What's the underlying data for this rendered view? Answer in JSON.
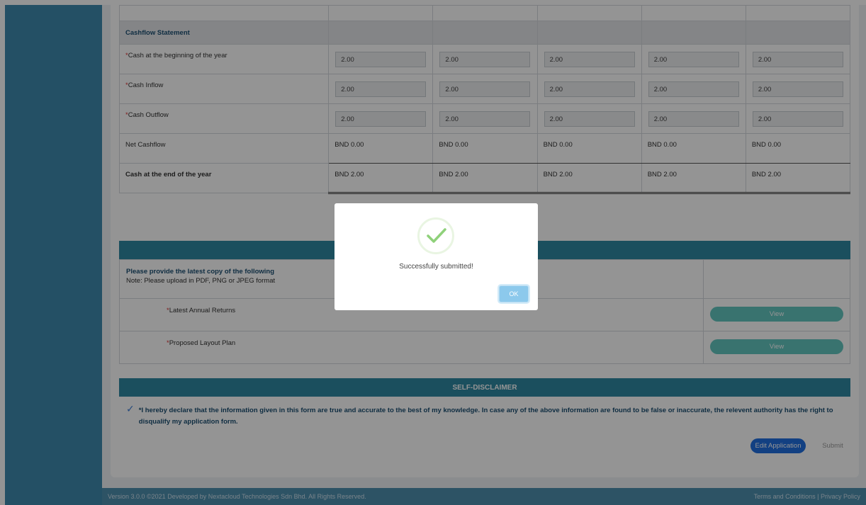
{
  "cashflow": {
    "section_title": "Cashflow Statement",
    "rows": [
      {
        "label": "Cash at the beginning of the year",
        "required": true,
        "type": "input",
        "values": [
          "2.00",
          "2.00",
          "2.00",
          "2.00",
          "2.00"
        ]
      },
      {
        "label": "Cash Inflow",
        "required": true,
        "type": "input",
        "values": [
          "2.00",
          "2.00",
          "2.00",
          "2.00",
          "2.00"
        ]
      },
      {
        "label": "Cash Outflow",
        "required": true,
        "type": "input",
        "values": [
          "2.00",
          "2.00",
          "2.00",
          "2.00",
          "2.00"
        ]
      },
      {
        "label": "Net Cashflow",
        "required": false,
        "type": "text",
        "values": [
          "BND 0.00",
          "BND 0.00",
          "BND 0.00",
          "BND 0.00",
          "BND 0.00"
        ]
      },
      {
        "label": "Cash at the end of the year",
        "required": false,
        "type": "text",
        "values": [
          "BND 2.00",
          "BND 2.00",
          "BND 2.00",
          "BND 2.00",
          "BND 2.00"
        ]
      }
    ]
  },
  "upload": {
    "heading": "Please provide the latest copy of the following",
    "note": "Note: Please upload in PDF, PNG or JPEG format",
    "items": [
      {
        "label": "Latest Annual Returns",
        "button": "View"
      },
      {
        "label": "Proposed Layout Plan",
        "button": "View"
      }
    ]
  },
  "disclaimer": {
    "title": "SELF-DISCLAIMER",
    "text": "*I hereby declare that the information given in this form are true and accurate to the best of my knowledge. In case any of the above information are found to be false or inaccurate, the relevent authority has the right to disqualify my application form."
  },
  "actions": {
    "edit": "Edit Application",
    "submit": "Submit"
  },
  "footer": {
    "left": "Version 3.0.0 ©2021 Developed by Nextacloud Technologies Sdn Bhd. All Rights Reserved.",
    "right": "Terms and Conditions | Privacy Policy"
  },
  "modal": {
    "message": "Successfully submitted!",
    "ok": "OK",
    "icon": "check-icon",
    "icon_color": "#8fd17a"
  }
}
